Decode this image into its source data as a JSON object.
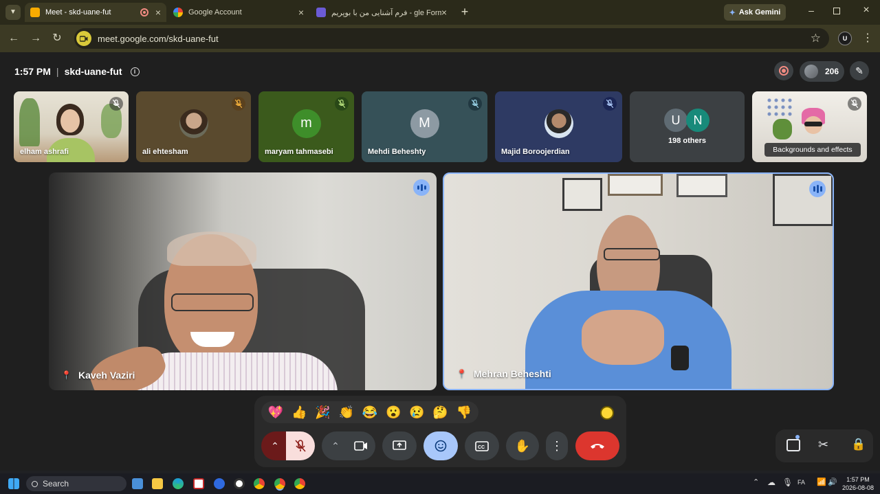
{
  "browser": {
    "tabs": [
      {
        "title": "Meet - skd-uane-fut",
        "active": true
      },
      {
        "title": "Google Account",
        "active": false
      },
      {
        "title": "فرم آشنایی من با بوپریم - gle Forms",
        "active": false
      }
    ],
    "new_tab": "+",
    "ask_gemini": "Ask Gemini",
    "url": "meet.google.com/skd-uane-fut",
    "profile_initials": "U"
  },
  "meet": {
    "time": "1:57 PM",
    "separator": "|",
    "code": "skd-uane-fut",
    "participant_count": "206",
    "filmstrip": [
      {
        "name": "elham ashrafi",
        "muted": true
      },
      {
        "name": "ali ehtesham",
        "muted": true,
        "avatar": "photo"
      },
      {
        "name": "maryam tahmasebi",
        "muted": true,
        "avatar": "m",
        "color": "#3e8e2a"
      },
      {
        "name": "Mehdi Beheshty",
        "muted": true,
        "avatar": "M",
        "color": "#8d9aa3"
      },
      {
        "name": "Majid Boroojerdian",
        "muted": true,
        "avatar": "photo"
      }
    ],
    "others": {
      "initials": [
        "U",
        "N"
      ],
      "label": "198 others"
    },
    "self_tooltip": "Backgrounds and effects",
    "main_tiles": [
      {
        "name": "Kaveh Vaziri",
        "speaking": true
      },
      {
        "name": "Mehran Beheshti",
        "speaking": true
      }
    ],
    "reactions": [
      "💖",
      "👍",
      "🎉",
      "👏",
      "😂",
      "😮",
      "😢",
      "🤔",
      "👎"
    ],
    "skin_tone": "🟡"
  },
  "taskbar": {
    "search": "Search",
    "clock_time": "1:57 PM",
    "clock_date": "2026-08-08",
    "lang": "FA"
  }
}
